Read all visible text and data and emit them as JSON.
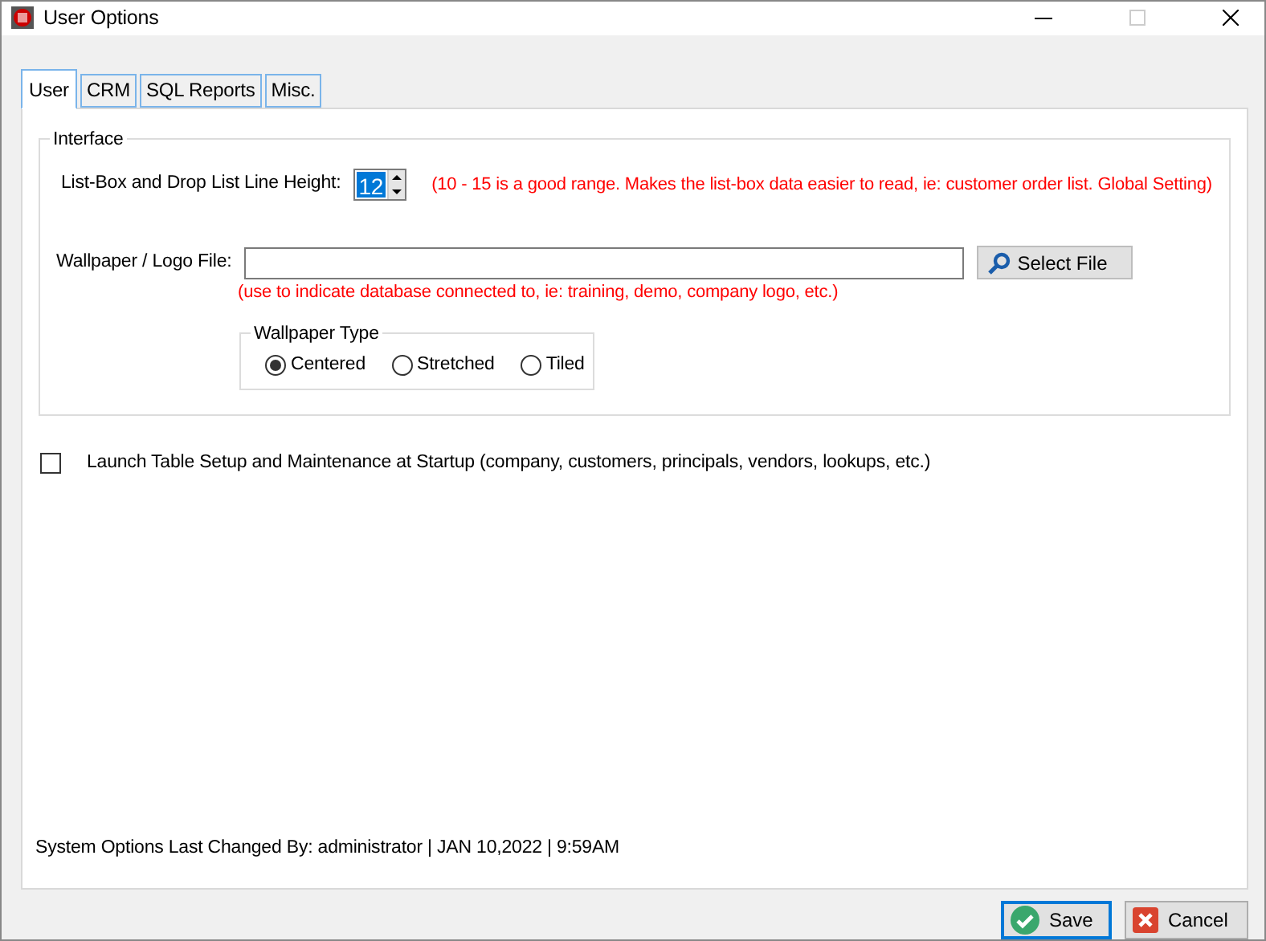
{
  "window": {
    "title": "User Options"
  },
  "tabs": [
    {
      "label": "User",
      "selected": true
    },
    {
      "label": "CRM",
      "selected": false
    },
    {
      "label": "SQL Reports",
      "selected": false
    },
    {
      "label": "Misc.",
      "selected": false
    }
  ],
  "interface": {
    "title": "Interface",
    "line_height": {
      "label": "List-Box and Drop List Line Height:",
      "value": "12",
      "note": "(10 - 15  is a good range. Makes the list-box data easier to read, ie: customer order list.  Global Setting)"
    },
    "wallpaper_file": {
      "label": "Wallpaper / Logo File:",
      "button": "Select File",
      "note": "(use to indicate database connected to, ie: training, demo, company logo, etc.)"
    },
    "wallpaper_type": {
      "title": "Wallpaper Type",
      "options": [
        {
          "label": "Centered",
          "selected": true
        },
        {
          "label": "Stretched",
          "selected": false
        },
        {
          "label": "Tiled",
          "selected": false
        }
      ]
    }
  },
  "launch_option": {
    "label": "Launch Table Setup and Maintenance at Startup (company, customers, principals, vendors, lookups, etc.)",
    "checked": false
  },
  "status": "System Options Last Changed By:  administrator | JAN 10,2022 |  9:59AM",
  "buttons": [
    {
      "label": "Save",
      "kind": "save"
    },
    {
      "label": "Cancel",
      "kind": "cancel"
    }
  ]
}
